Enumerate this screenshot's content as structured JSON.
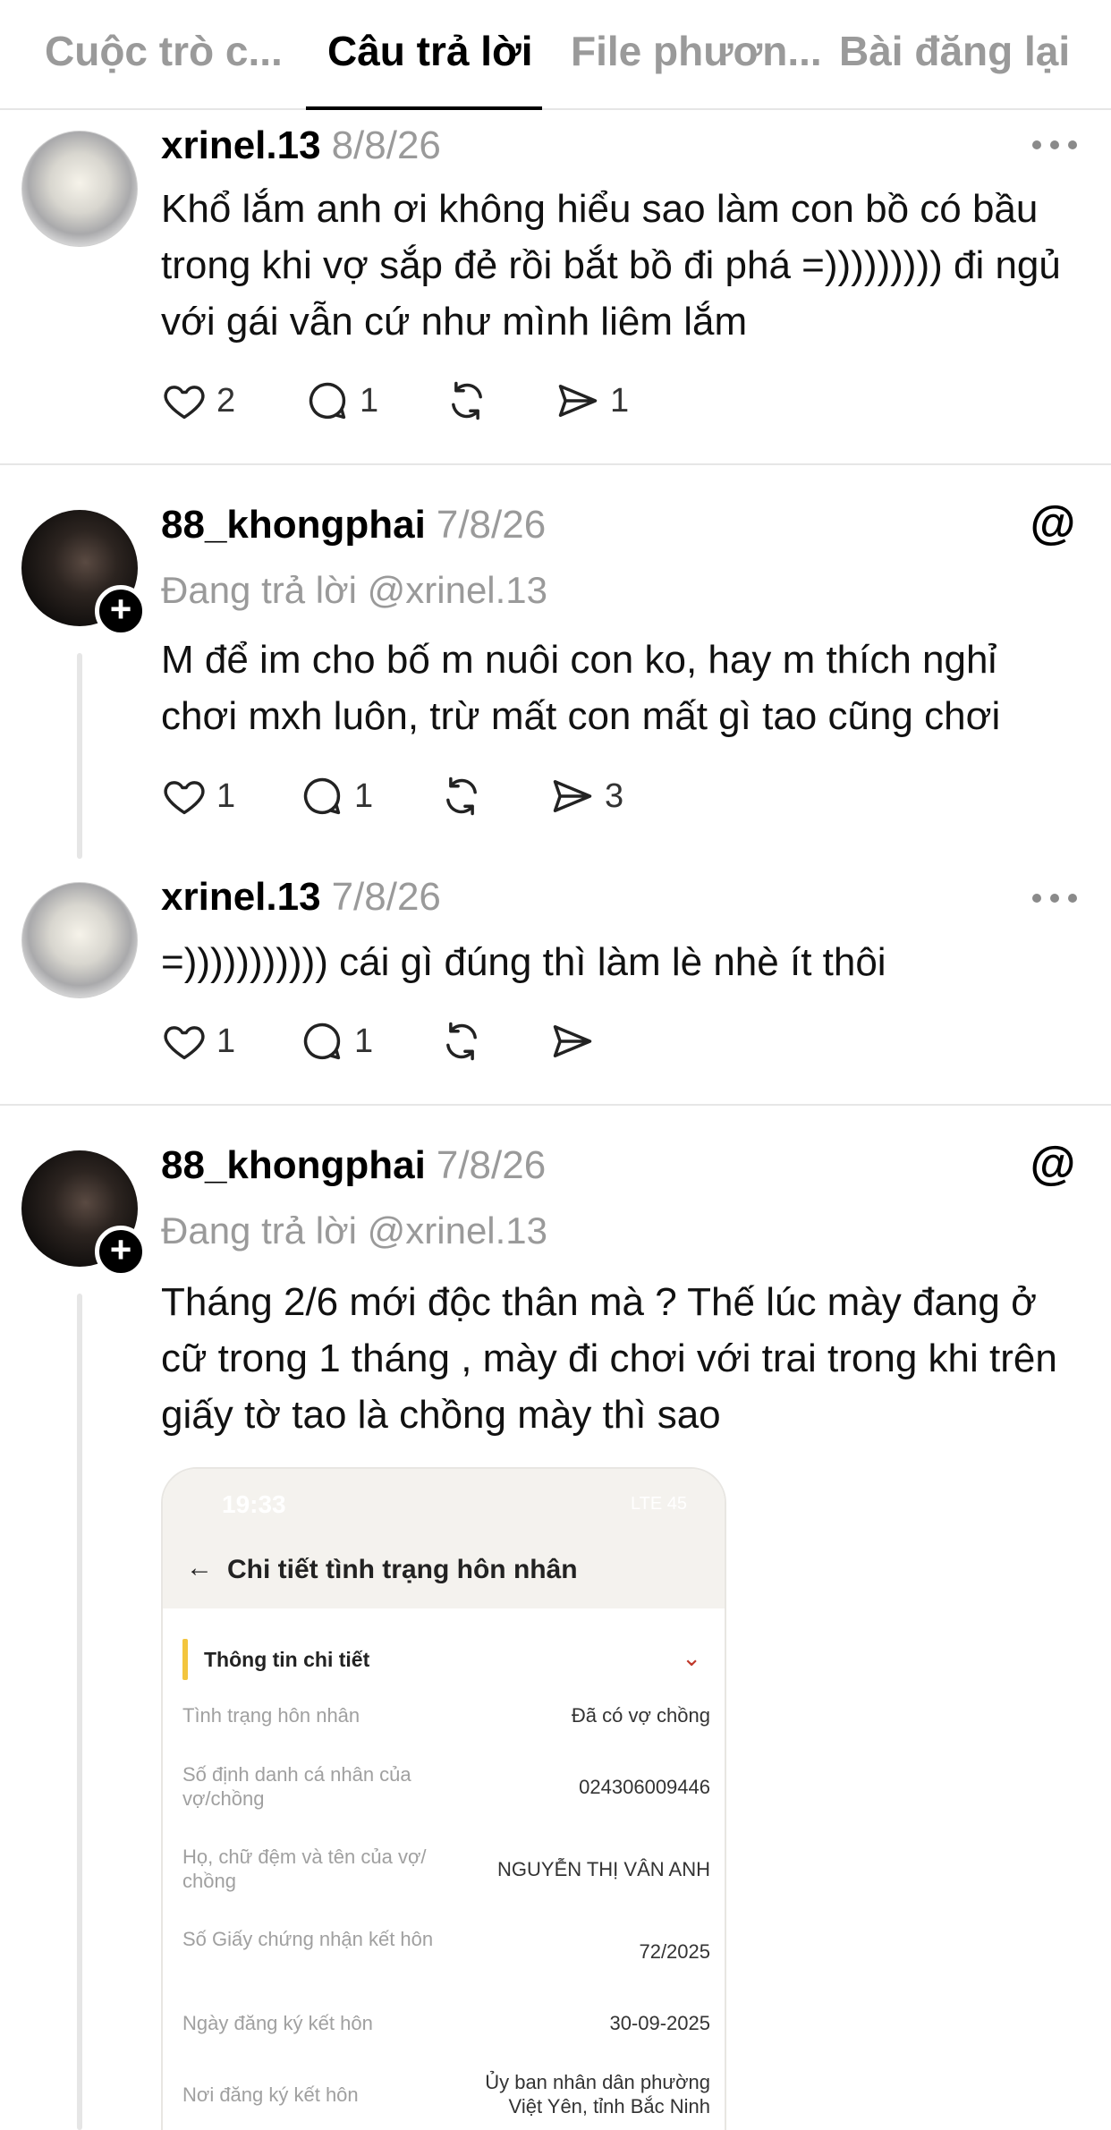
{
  "tabs": [
    {
      "label": "Cuộc trò c..."
    },
    {
      "label": "Câu trả lời"
    },
    {
      "label": "File phươn..."
    },
    {
      "label": "Bài đăng lại"
    }
  ],
  "posts": [
    {
      "username": "xrinel.13",
      "date": "8/8/26",
      "text": "Khổ lắm anh ơi không hiểu sao làm con bồ có bầu trong khi vợ sắp đẻ rồi bắt bồ đi phá =))))))))) đi ngủ với gái vẫn cứ như mình liêm lắm",
      "likes": "2",
      "replies": "1",
      "shares": "1"
    },
    {
      "username": "88_khongphai",
      "date": "7/8/26",
      "reply_to": "Đang trả lời @xrinel.13",
      "text": "M để im cho bố m nuôi con ko, hay m thích nghỉ chơi mxh luôn, trừ mất con mất gì tao cũng chơi",
      "likes": "1",
      "replies": "1",
      "shares": "3"
    },
    {
      "username": "xrinel.13",
      "date": "7/8/26",
      "text": "=))))))))))) cái gì đúng thì làm lè nhè ít thôi",
      "likes": "1",
      "replies": "1"
    },
    {
      "username": "88_khongphai",
      "date": "7/8/26",
      "reply_to": "Đang trả lời @xrinel.13",
      "text": "Tháng 2/6 mới độc thân mà ? Thế lúc mày đang ở cữ trong 1 tháng , mày đi chơi với trai trong khi trên giấy tờ tao là chồng mày thì sao"
    }
  ],
  "attachment": {
    "time": "19:33",
    "status": "LTE 45",
    "title": "Chi tiết tình trạng hôn nhân",
    "section_title": "Thông tin chi tiết",
    "rows": [
      {
        "label": "Tình trạng hôn nhân",
        "value": "Đã có vợ chồng"
      },
      {
        "label": "Số định danh cá nhân của vợ/chồng",
        "value": "024306009446"
      },
      {
        "label": "Họ, chữ đệm và tên của vợ/ chồng",
        "value": "NGUYỄN THỊ VÂN ANH"
      },
      {
        "label": "Số Giấy chứng nhận kết hôn",
        "value": "72/2025"
      },
      {
        "label": "Ngày đăng ký kết hôn",
        "value": "30-09-2025"
      },
      {
        "label": "Nơi đăng ký kết hôn",
        "value": "Ủy ban nhân dân phường Việt Yên, tỉnh Bắc Ninh"
      }
    ]
  },
  "icons": {
    "more": "more-horizontal-icon",
    "threads": "threads-logo-icon",
    "like": "heart-icon",
    "reply": "comment-icon",
    "repost": "repost-icon",
    "share": "send-icon",
    "back": "arrow-left-icon",
    "chevron": "chevron-down-icon"
  }
}
